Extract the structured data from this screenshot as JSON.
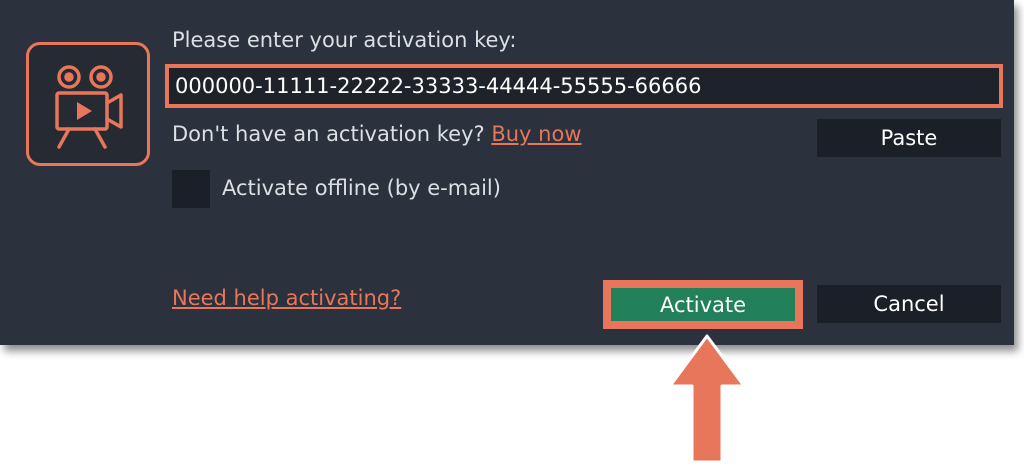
{
  "dialog": {
    "app_icon": "movie-camera-icon",
    "prompt": "Please enter your activation key:",
    "key_value": "000000-11111-22222-33333-44444-55555-66666",
    "no_key_text": "Don't have an activation key?",
    "buy_link": "Buy now",
    "paste_label": "Paste",
    "offline_label": "Activate offline (by e-mail)",
    "offline_checked": false,
    "help_link": "Need help activating?",
    "activate_label": "Activate",
    "cancel_label": "Cancel"
  },
  "colors": {
    "background": "#2b313d",
    "accent": "#e8765b",
    "activate_green": "#22805a",
    "button_dark": "#1b2028",
    "text": "#dcdfe4"
  },
  "annotation": {
    "arrow_icon": "arrow-up-icon",
    "target": "Activate"
  }
}
